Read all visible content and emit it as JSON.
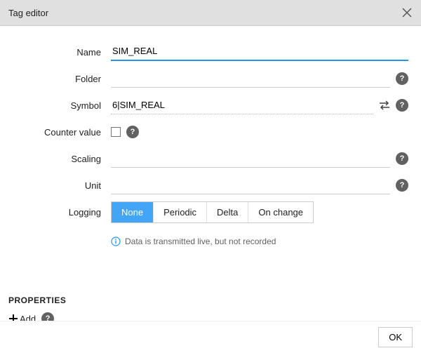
{
  "dialog": {
    "title": "Tag editor"
  },
  "fields": {
    "name": {
      "label": "Name",
      "value": "SIM_REAL"
    },
    "folder": {
      "label": "Folder",
      "value": ""
    },
    "symbol": {
      "label": "Symbol",
      "value": "6|SIM_REAL"
    },
    "counter": {
      "label": "Counter value"
    },
    "scaling": {
      "label": "Scaling",
      "value": ""
    },
    "unit": {
      "label": "Unit",
      "value": ""
    },
    "logging": {
      "label": "Logging",
      "options": [
        "None",
        "Periodic",
        "Delta",
        "On change"
      ],
      "selected": 0,
      "info": "Data is transmitted live, but not recorded"
    }
  },
  "properties": {
    "heading": "PROPERTIES",
    "add_label": "Add"
  },
  "footer": {
    "ok": "OK"
  },
  "icons": {
    "help": "?"
  }
}
